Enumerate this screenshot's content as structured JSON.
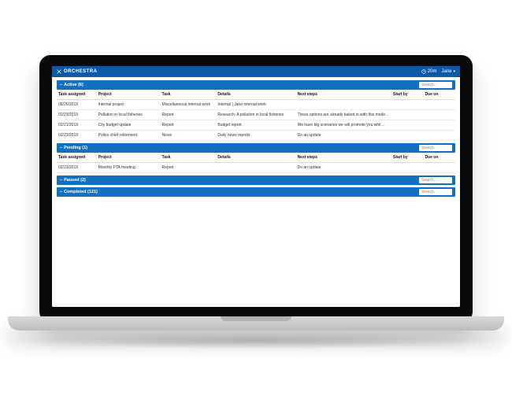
{
  "header": {
    "brand": "ORCHESTRA",
    "timer": "20m",
    "user": "Jane"
  },
  "search_placeholder": "Search...",
  "columns": {
    "task_assigned": "Task assigned",
    "project": "Project",
    "task": "Task",
    "details": "Details",
    "next_steps": "Next steps",
    "start_by": "Start by",
    "due_on": "Due on"
  },
  "sections": [
    {
      "title": "Active (6)",
      "rows": [
        {
          "date": "06/26/2019",
          "project": "Internal project",
          "task": "Miscellaneous internal work",
          "details": "Internal | Jane internal work",
          "next": ""
        },
        {
          "date": "02/23/2019",
          "project": "Pollution in local fisheries",
          "task": "Report",
          "details": "Research: A pollution in local fisheries",
          "next": "These options are already baked in with this model shoot…"
        },
        {
          "date": "02/21/2019",
          "project": "City budget update",
          "task": "Report",
          "details": "Budget report",
          "next": "We have big scenarios we will promote you whil…"
        },
        {
          "date": "02/23/2019",
          "project": "Police chief retirement",
          "task": "News",
          "details": "Daily news reports",
          "next": "Do an update"
        }
      ]
    },
    {
      "title": "Pending (1)",
      "rows": [
        {
          "date": "02/23/2019",
          "project": "Monthly PTA meeting",
          "task": "Report",
          "details": "",
          "next": "Do an update"
        }
      ]
    },
    {
      "title": "Paused (2)",
      "rows": []
    },
    {
      "title": "Completed (121)",
      "rows": []
    }
  ]
}
